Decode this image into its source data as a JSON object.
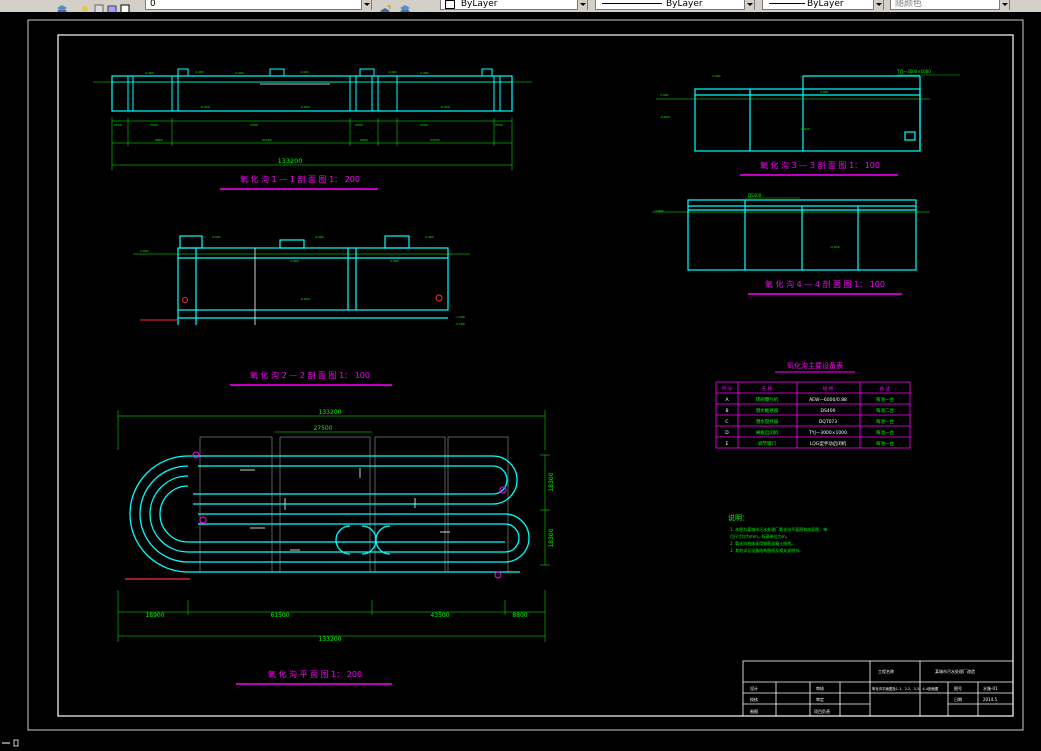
{
  "toolbar": {
    "layer_value": "0",
    "color_value": "ByLayer",
    "linetype_value": "ByLayer",
    "lineweight_value": "ByLayer",
    "plotstyle_value": "随颜色"
  },
  "drawing": {
    "section_1_1": {
      "title": "氧 化 沟 1 — 1 剖 面 图   1： 200",
      "total_dim": "133200"
    },
    "section_2_2": {
      "title": "氧 化 沟 2 — 2 剖 面 图   1： 100"
    },
    "section_3_3": {
      "title": "氧 化 沟 3 — 3 剖 面 图   1： 100",
      "label_top": "TYJ—3000×1000"
    },
    "section_4_4": {
      "title": "氧 化 沟 4 — 4 剖 面 图   1： 100",
      "label_top": "DS400"
    },
    "plan": {
      "title": "氧 化 沟 平 面 图   1： 200",
      "dim_top_total": "133200",
      "dim_top_inner": "27500",
      "dim_right_1": "18300",
      "dim_right_2": "18300",
      "dim_bottom_1": "18900",
      "dim_bottom_2": "61500",
      "dim_bottom_3": "43500",
      "dim_bottom_4": "8800",
      "dim_bottom_total": "133200"
    },
    "equipment_table": {
      "title": "氧化沟主要设备表",
      "headers": [
        "序 号",
        "名   称",
        "规   格",
        "备   注"
      ],
      "rows": [
        [
          "A",
          "转刷曝气机",
          "AEW—6000/0.88",
          "每池一台"
        ],
        [
          "B",
          "潜水推进器",
          "DS400",
          "每池二台"
        ],
        [
          "C",
          "潜水搅拌器",
          "DQT073",
          "每池一台"
        ],
        [
          "D",
          "闸板启闭机",
          "TYJ—3000×1000",
          "每池一台"
        ],
        [
          "E",
          "调节堰门",
          "LQG型手动启闭机",
          "每池一台"
        ]
      ]
    },
    "notes": {
      "heading": "说明：",
      "lines": [
        "1. 本图为某城市污水处理厂氧化沟平面图和剖面图，单",
        "位尺寸均为mm，标高单位为m。",
        "2. 氧化沟池体采用钢筋混凝土结构。",
        "3. 其他详见设备结构图纸及相关说明书。"
      ]
    },
    "title_block": {
      "project_label": "工程名称",
      "project_value": "某城市污水处理厂改造",
      "row1_labels": [
        "设计",
        "审核"
      ],
      "row2_labels": [
        "校核",
        "审定"
      ],
      "row3_labels": [
        "制图",
        "项目负责"
      ],
      "drawing_name": "氧化沟平面图及1-1、2-2、3-3、4-4剖面图",
      "drawing_no_label": "图号",
      "drawing_no_value": "水施-01",
      "date_label": "日期",
      "date_value": "2014.5"
    }
  },
  "colors": {
    "background": "#000000",
    "structure": "#00ffff",
    "dimension": "#00ff00",
    "title_underline": "#ff00ff",
    "text": "#ffffff",
    "accent_red": "#ff3030",
    "toolbar": "#d4d0c8"
  }
}
